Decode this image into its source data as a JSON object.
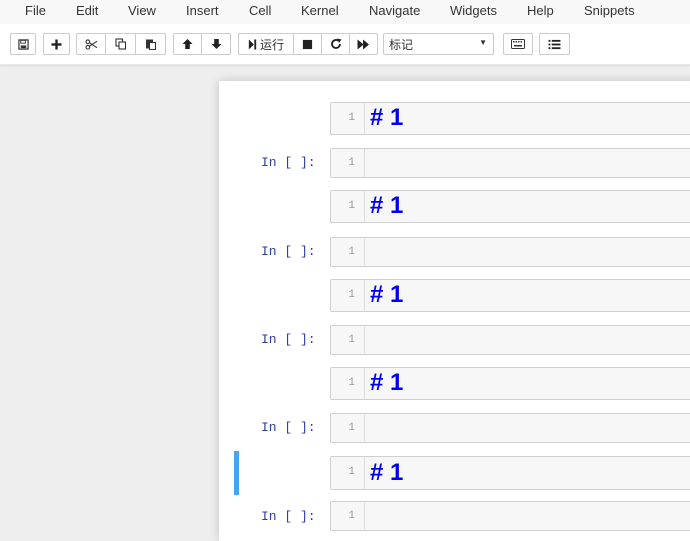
{
  "menubar": {
    "items": [
      "File",
      "Edit",
      "View",
      "Insert",
      "Cell",
      "Kernel",
      "Navigate",
      "Widgets",
      "Help",
      "Snippets"
    ]
  },
  "toolbar": {
    "save_icon": "save-icon",
    "add_icon": "plus-icon",
    "cut_icon": "scissors-icon",
    "copy_icon": "copy-icon",
    "paste_icon": "paste-icon",
    "move_up_icon": "arrow-up-icon",
    "move_down_icon": "arrow-down-icon",
    "run_label": "运行",
    "interrupt_icon": "stop-icon",
    "restart_icon": "restart-icon",
    "restart_run_all_icon": "fast-forward-icon",
    "cell_type_selected": "标记",
    "keyboard_icon": "keyboard-icon",
    "command_palette_icon": "list-icon"
  },
  "cells": [
    {
      "type": "markdown",
      "prompt": "",
      "line": "1",
      "content": "# 1"
    },
    {
      "type": "code",
      "prompt": "In [ ]:",
      "line": "1",
      "content": ""
    },
    {
      "type": "markdown",
      "prompt": "",
      "line": "1",
      "content": "# 1"
    },
    {
      "type": "code",
      "prompt": "In [ ]:",
      "line": "1",
      "content": ""
    },
    {
      "type": "markdown",
      "prompt": "",
      "line": "1",
      "content": "# 1"
    },
    {
      "type": "code",
      "prompt": "In [ ]:",
      "line": "1",
      "content": ""
    },
    {
      "type": "markdown",
      "prompt": "",
      "line": "1",
      "content": "# 1"
    },
    {
      "type": "code",
      "prompt": "In [ ]:",
      "line": "1",
      "content": ""
    },
    {
      "type": "markdown",
      "prompt": "",
      "line": "1",
      "content": "# 1",
      "selected": true
    },
    {
      "type": "code",
      "prompt": "In [ ]:",
      "line": "1",
      "content": ""
    }
  ],
  "colors": {
    "selected_bar": "#42a5f5",
    "markdown_heading": "#0000ee",
    "prompt": "#303f9f"
  }
}
